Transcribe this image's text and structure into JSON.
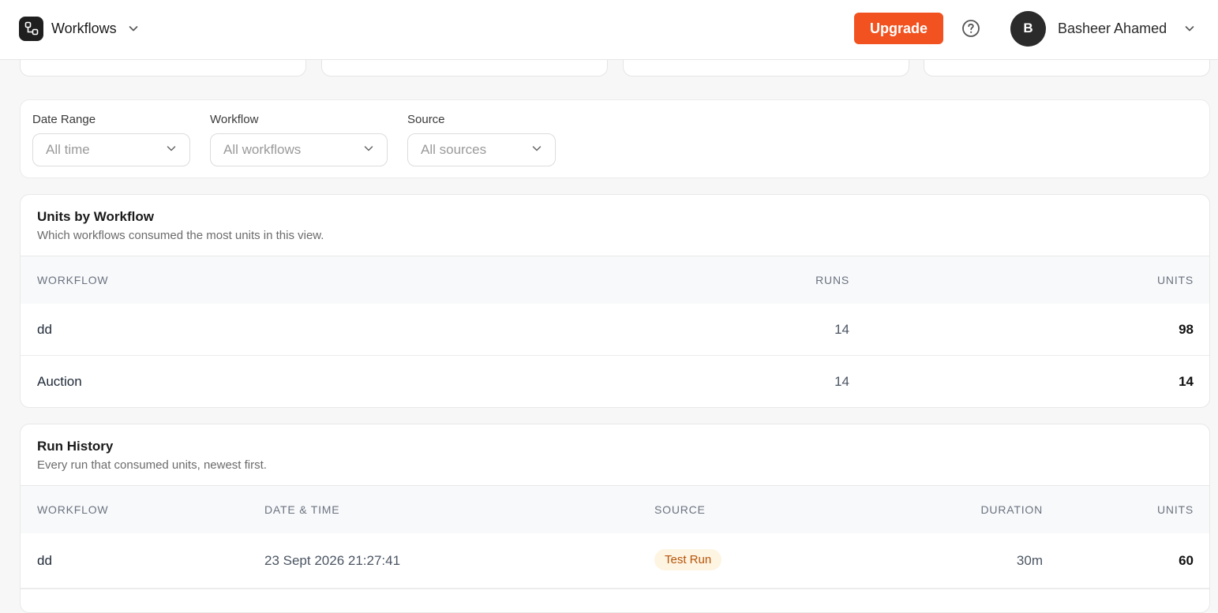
{
  "header": {
    "app_title": "Workflows",
    "upgrade_label": "Upgrade",
    "user": {
      "initial": "B",
      "name": "Basheer Ahamed"
    }
  },
  "filters": {
    "date_range": {
      "label": "Date Range",
      "value": "All time"
    },
    "workflow": {
      "label": "Workflow",
      "value": "All workflows"
    },
    "source": {
      "label": "Source",
      "value": "All sources"
    }
  },
  "units_by_workflow": {
    "title": "Units by Workflow",
    "subtitle": "Which workflows consumed the most units in this view.",
    "columns": [
      "WORKFLOW",
      "RUNS",
      "UNITS"
    ],
    "rows": [
      {
        "workflow": "dd",
        "runs": "14",
        "units": "98"
      },
      {
        "workflow": "Auction",
        "runs": "14",
        "units": "14"
      }
    ]
  },
  "run_history": {
    "title": "Run History",
    "subtitle": "Every run that consumed units, newest first.",
    "columns": [
      "WORKFLOW",
      "DATE & TIME",
      "SOURCE",
      "DURATION",
      "UNITS"
    ],
    "rows": [
      {
        "workflow": "dd",
        "datetime": "23 Sept 2026 21:27:41",
        "source": "Test Run",
        "duration": "30m",
        "units": "60"
      }
    ]
  },
  "colors": {
    "accent": "#f1521f",
    "badge_bg": "#fef4e2",
    "badge_text": "#b45309"
  }
}
